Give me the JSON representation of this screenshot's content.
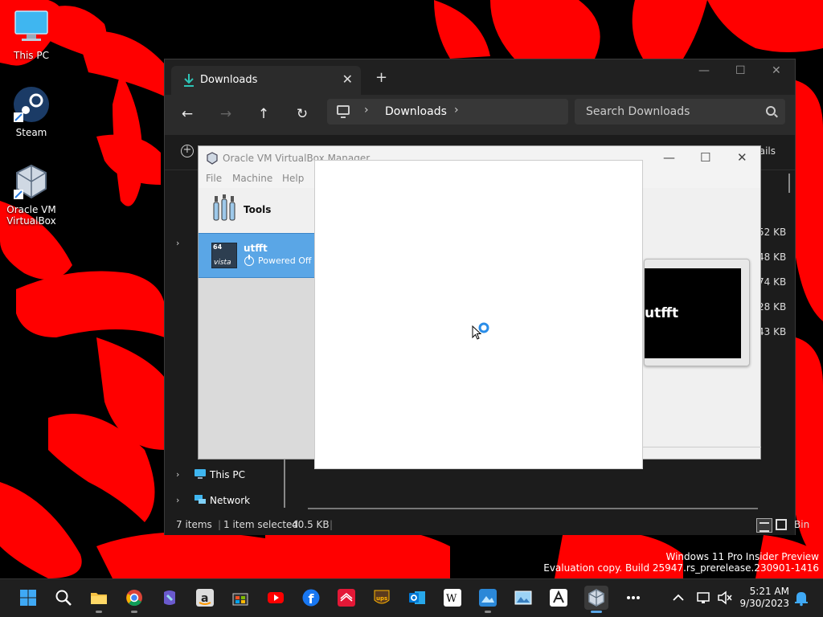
{
  "desktop": {
    "icons": [
      {
        "label": "This PC"
      },
      {
        "label": "Steam"
      },
      {
        "label_line1": "Oracle VM",
        "label_line2": "VirtualBox"
      }
    ],
    "watermark": {
      "line1": "Windows 11 Pro Insider Preview",
      "line2": "Evaluation copy. Build 25947.rs_prerelease.230901-1416"
    }
  },
  "explorer": {
    "tab_title": "Downloads",
    "tab_close": "✕",
    "new_tab": "+",
    "window_controls": {
      "minimize": "—",
      "maximize": "☐",
      "close": "✕"
    },
    "nav": {
      "back": "←",
      "forward": "→",
      "up": "↑",
      "refresh": "↻"
    },
    "address": {
      "separator": "›",
      "crumb": "Downloads"
    },
    "search_placeholder": "Search Downloads",
    "details_label": "ails",
    "sidebar": {
      "expand": "›",
      "this_pc": "This PC",
      "network": "Network"
    },
    "size_column": [
      "52 KB",
      "48 KB",
      "74 KB",
      "28 KB",
      "43 KB"
    ],
    "status": {
      "items": "7 items",
      "selected": "1 item selected",
      "size": "40.5 KB",
      "bin": "Bin"
    }
  },
  "vbox": {
    "title": "Oracle VM VirtualBox Manager",
    "menu": [
      "File",
      "Machine",
      "Help"
    ],
    "tools_label": "Tools",
    "vm": {
      "badge": "64",
      "os": "vista",
      "name": "utfft",
      "state": "Powered Off"
    },
    "preview_name": "utfft",
    "window_controls": {
      "minimize": "—",
      "maximize": "☐",
      "close": "✕"
    }
  },
  "taskbar": {
    "apps": [
      "start",
      "search",
      "file-explorer",
      "chrome",
      "copilot",
      "amazon",
      "store",
      "youtube",
      "facebook",
      "bank",
      "ups",
      "outlook",
      "wikipedia",
      "photos",
      "gallery",
      "adobe",
      "virtualbox",
      "more"
    ],
    "clock": {
      "time": "5:21 AM",
      "date": "9/30/2023"
    }
  },
  "colors": {
    "wallpaper_red": "#ff0000",
    "accent_blue": "#5aa6e6",
    "explorer_bg": "#1c1c1c"
  }
}
